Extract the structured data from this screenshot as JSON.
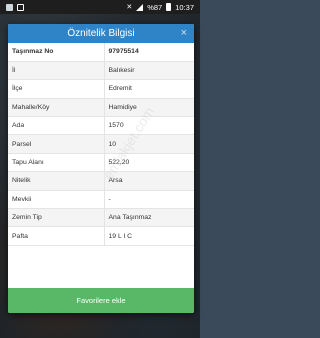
{
  "statusbar": {
    "battery": "%87",
    "time": "10:37"
  },
  "dialog": {
    "title": "Öznitelik Bilgisi",
    "close_label": "×",
    "rows": [
      {
        "key": "Taşınmaz No",
        "value": "97975514"
      },
      {
        "key": "İl",
        "value": "Balıkesir"
      },
      {
        "key": "İlçe",
        "value": "Edremit"
      },
      {
        "key": "Mahalle/Köy",
        "value": "Hamidiye"
      },
      {
        "key": "Ada",
        "value": "1570"
      },
      {
        "key": "Parsel",
        "value": "10"
      },
      {
        "key": "Tapu Alanı",
        "value": "522,20"
      },
      {
        "key": "Nitelik",
        "value": "Arsa"
      },
      {
        "key": "Mevkii",
        "value": "-"
      },
      {
        "key": "Zemin Tip",
        "value": "Ana Taşınmaz"
      },
      {
        "key": "Pafta",
        "value": "19 L I C"
      }
    ],
    "favorite_label": "Favorilere ekle"
  },
  "watermark": "emlakjet.com"
}
